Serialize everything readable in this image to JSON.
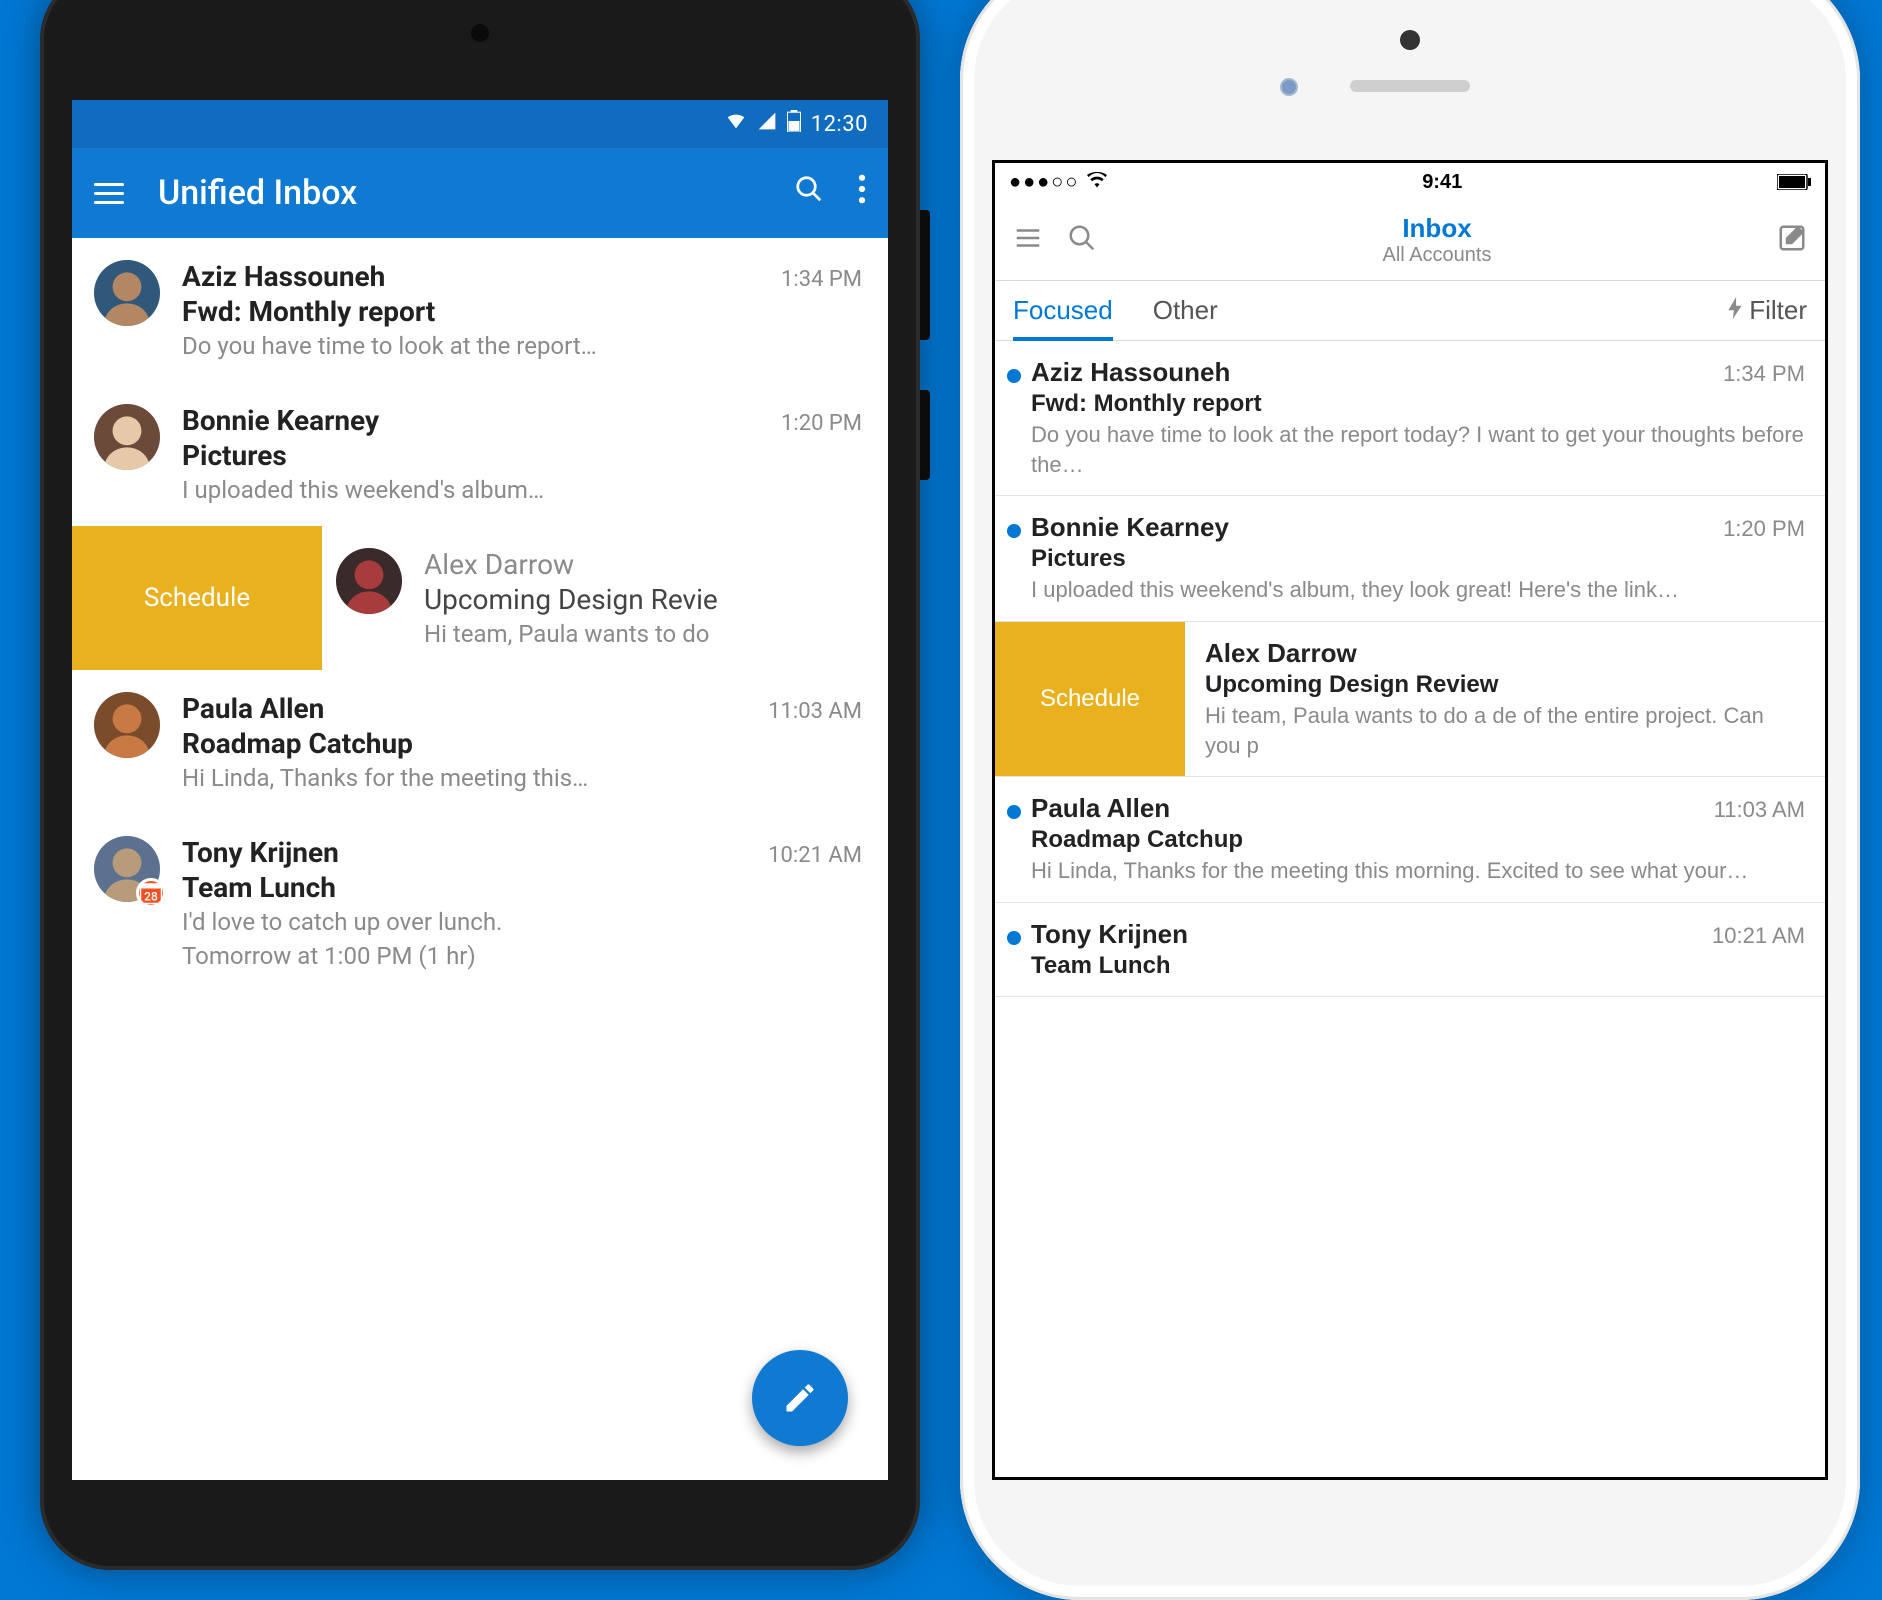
{
  "android": {
    "statusbar_time": "12:30",
    "appbar_title": "Unified Inbox",
    "swipe_action_label": "Schedule",
    "emails": [
      {
        "sender": "Aziz Hassouneh",
        "time": "1:34 PM",
        "subject": "Fwd: Monthly report",
        "preview": "Do you have time to look at the report…",
        "unread": true,
        "avatar_bg": "#b38763",
        "avatar_bg2": "#2f587a"
      },
      {
        "sender": "Bonnie Kearney",
        "time": "1:20 PM",
        "subject": "Pictures",
        "preview": "I uploaded this weekend's album…",
        "unread": true,
        "avatar_bg": "#e6c9a8",
        "avatar_bg2": "#6b4a3a"
      },
      {
        "sender": "Alex Darrow",
        "time": "",
        "subject": "Upcoming Design Revie",
        "preview": "Hi team, Paula wants to do",
        "unread": false,
        "avatar_bg": "#a83b3b",
        "avatar_bg2": "#3a2a2a",
        "swiped": true
      },
      {
        "sender": "Paula Allen",
        "time": "11:03 AM",
        "subject": "Roadmap Catchup",
        "preview": "Hi Linda, Thanks for the meeting this…",
        "unread": true,
        "avatar_bg": "#c97a44",
        "avatar_bg2": "#7a4c2b"
      },
      {
        "sender": "Tony Krijnen",
        "time": "10:21 AM",
        "subject": "Team Lunch",
        "preview": "I'd love to catch up over lunch.",
        "meta": "Tomorrow at 1:00 PM (1 hr)",
        "unread": true,
        "avatar_bg": "#b79b7a",
        "avatar_bg2": "#5b718f",
        "calendar_badge": true
      }
    ]
  },
  "ios": {
    "statusbar_time": "9:41",
    "nav_title": "Inbox",
    "nav_subtitle": "All Accounts",
    "tab_focused": "Focused",
    "tab_other": "Other",
    "filter_label": "Filter",
    "swipe_action_label": "Schedule",
    "emails": [
      {
        "sender": "Aziz Hassouneh",
        "time": "1:34 PM",
        "subject": "Fwd: Monthly report",
        "preview": "Do you have time to look at the report today? I want to get your thoughts before the…",
        "unread": true
      },
      {
        "sender": "Bonnie Kearney",
        "time": "1:20 PM",
        "subject": "Pictures",
        "preview": "I uploaded this weekend's album, they look great! Here's the link…",
        "unread": true
      },
      {
        "sender": "Alex Darrow",
        "time": "",
        "subject": "Upcoming Design Review",
        "preview": "Hi team, Paula wants to do a de of the entire project. Can you p",
        "unread": true,
        "swiped": true
      },
      {
        "sender": "Paula Allen",
        "time": "11:03 AM",
        "subject": "Roadmap Catchup",
        "preview": "Hi Linda, Thanks for the meeting this morning. Excited to see what your…",
        "unread": true
      },
      {
        "sender": "Tony Krijnen",
        "time": "10:21 AM",
        "subject": "Team Lunch",
        "preview": "",
        "unread": true
      }
    ]
  }
}
